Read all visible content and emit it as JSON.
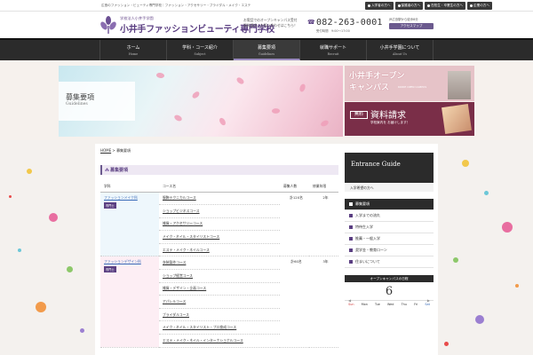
{
  "topbar": {
    "tagline": "広島のファッション・ビューティ専門学校｜ファッション・アクセサリー・ブライダル・メイク・エステ",
    "links": [
      {
        "label": "入学者の方へ",
        "icon": "person-icon"
      },
      {
        "label": "保護者の方へ",
        "icon": "person-icon"
      },
      {
        "label": "在校生・卒業生の方へ",
        "icon": "person-icon"
      },
      {
        "label": "企業の方へ",
        "icon": "building-icon"
      }
    ]
  },
  "header": {
    "logo_sub": "学校法人小井手学園",
    "logo_main": "小井手ファッションビューティ専門学校",
    "contact_line1": "お電話でのオープンキャンパス受付",
    "contact_line2": "資料請求・お問い合わせはこちら！",
    "tel": "082-263-0001",
    "tel_hours": "受付時間　9:00～17:00",
    "access_text": "JR広島駅から徒歩8分",
    "access_btn": "アクセスマップ"
  },
  "nav": [
    {
      "jp": "ホーム",
      "en": "Home",
      "active": false
    },
    {
      "jp": "学科・コース紹介",
      "en": "Subject",
      "active": false
    },
    {
      "jp": "募集要項",
      "en": "Guidelines",
      "active": true
    },
    {
      "jp": "就職サポート",
      "en": "Recruit",
      "active": false
    },
    {
      "jp": "小井手学園について",
      "en": "About Us",
      "active": false
    }
  ],
  "hero": {
    "title": "募集要項",
    "title_en": "Guidelines",
    "banner_open_l1": "小井手オープン",
    "banner_open_l2": "キャンパス",
    "banner_open_en": "KOIDE OPEN CAMPUS",
    "banner_req_badge": "無料",
    "banner_req_title": "資料請求",
    "banner_req_sub": "学校案内を お届けします！"
  },
  "breadcrumb": {
    "home": "HOME",
    "sep": ">",
    "current": "募集要項"
  },
  "section_title": "募集要項",
  "table": {
    "headers": [
      "学科",
      "コース名",
      "募集人数",
      "修業年限"
    ],
    "departments": [
      {
        "name": "ファッションメイク科",
        "badge": "専門士",
        "capacity": "計120名",
        "years": "2年",
        "courses": [
          "服飾テクニカルコース",
          "ショップビジネスコース",
          "雑貨・アクセサリーコース",
          "メイク・ネイル・スタイリストコース",
          "エステ・メイク・ネイルコース"
        ]
      },
      {
        "name": "ファッションデザイン科",
        "badge": "専門士",
        "capacity": "計60名",
        "years": "3年",
        "courses": [
          "衣装製作コース",
          "ショップ経営コース",
          "雑貨・デザイン・企画コース",
          "アパレルコース",
          "ブライダルコース",
          "メイク・ネイル・スタイリスト・プロ育成コース",
          "エステ・メイク・ネイル・インターナショナルコース"
        ]
      }
    ]
  },
  "sidebar": {
    "title": "Entrance Guide",
    "subtitle": "入学希望の方へ",
    "items": [
      {
        "label": "募集要項",
        "active": true
      },
      {
        "label": "入学までの流れ",
        "active": false
      },
      {
        "label": "特待生入学",
        "active": false
      },
      {
        "label": "推薦・一般入学",
        "active": false
      },
      {
        "label": "奨学金・教育ローン",
        "active": false
      },
      {
        "label": "住まいについて",
        "active": false
      }
    ],
    "calendar": {
      "title": "オープンキャンパスの日程",
      "day": "6",
      "prev": "◀",
      "next": "▶",
      "weekdays": [
        "Sun",
        "Mon",
        "Tue",
        "Wed",
        "Thu",
        "Fri",
        "Sat"
      ]
    }
  },
  "colors": {
    "brand": "#5b3f82",
    "nav": "#2b2b2b",
    "link": "#3a6bb8"
  }
}
